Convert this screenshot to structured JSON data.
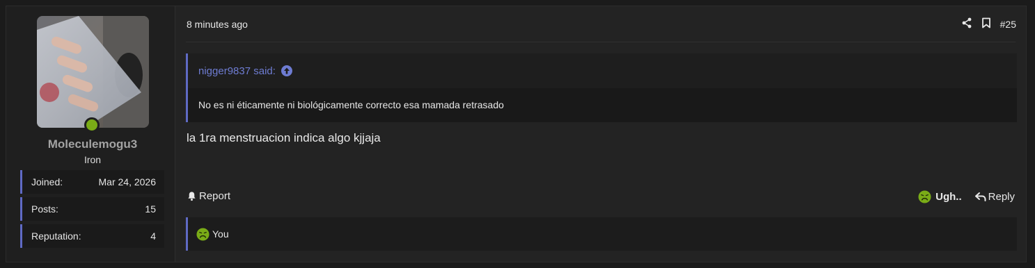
{
  "user": {
    "name": "Moleculemogu3",
    "title": "Iron",
    "online_color": "#7aac17",
    "stats": [
      {
        "label": "Joined:",
        "value": "Mar 24, 2026"
      },
      {
        "label": "Posts:",
        "value": "15"
      },
      {
        "label": "Reputation:",
        "value": "4"
      }
    ]
  },
  "post": {
    "time": "8 minutes ago",
    "number": "#25",
    "icons": {
      "share": "share-icon",
      "bookmark": "bookmark-icon"
    },
    "quote": {
      "author": "nigger9837 said:",
      "text": "No es ni éticamente ni biológicamente correcto esa mamada retrasado"
    },
    "message": "la 1ra menstruacion indica algo kjjaja"
  },
  "footer": {
    "report_label": "Report",
    "reaction_label": "Ugh..",
    "reply_label": "Reply"
  },
  "reactions": {
    "who": "You"
  },
  "colors": {
    "accent": "#5f6ac4",
    "quote_author": "#6e7cd2",
    "reaction_emoji": "#7aac17"
  }
}
